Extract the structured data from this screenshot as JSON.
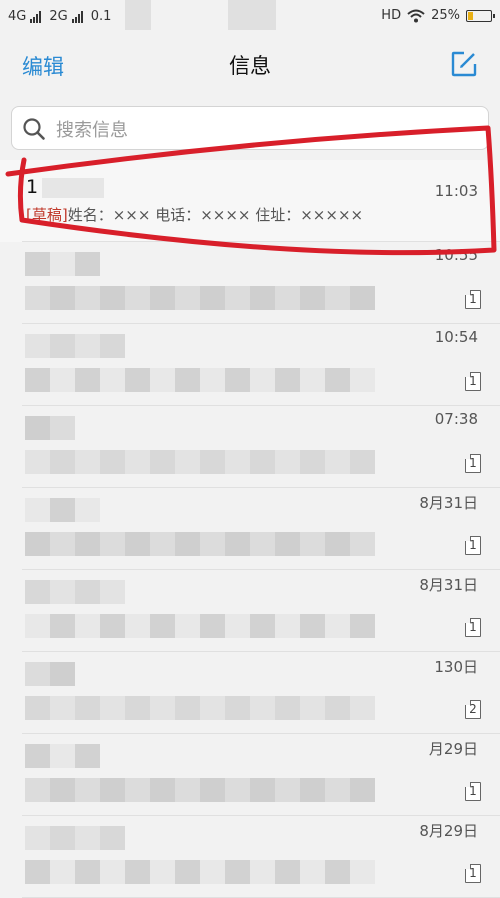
{
  "status_bar": {
    "network1": "4G",
    "network2": "2G",
    "speed": "0.1",
    "hd": "HD",
    "battery": "25%",
    "battery_level": 0.25,
    "wifi_icon": "wifi-icon"
  },
  "header": {
    "edit_label": "编辑",
    "title": "信息",
    "compose_icon": "compose-icon"
  },
  "search": {
    "placeholder": "搜索信息",
    "icon": "search-icon"
  },
  "messages": [
    {
      "sender": "1",
      "time": "11:03",
      "draft_tag": "[草稿]",
      "preview": "姓名：××× 电话：×××× 住址：×××××",
      "sim": ""
    },
    {
      "sender": "",
      "time": "10:55",
      "draft_tag": "",
      "preview": "",
      "sim": "1"
    },
    {
      "sender": "",
      "time": "10:54",
      "draft_tag": "",
      "preview": "",
      "sim": "1"
    },
    {
      "sender": "",
      "time": "07:38",
      "draft_tag": "",
      "preview": "",
      "sim": "1"
    },
    {
      "sender": "",
      "time": "8月31日",
      "draft_tag": "",
      "preview": "",
      "sim": "1"
    },
    {
      "sender": "",
      "time": "8月31日",
      "draft_tag": "",
      "preview": "",
      "sim": "1"
    },
    {
      "sender": "",
      "time": "130日",
      "draft_tag": "",
      "preview": "",
      "sim": "2"
    },
    {
      "sender": "",
      "time": "月29日",
      "draft_tag": "",
      "preview": "",
      "sim": "1"
    },
    {
      "sender": "",
      "time": "8月29日",
      "draft_tag": "",
      "preview": "",
      "sim": "1"
    }
  ],
  "colors": {
    "accent": "#2a8ad3",
    "draft": "#c0392b",
    "annotation": "#d81f2a"
  }
}
